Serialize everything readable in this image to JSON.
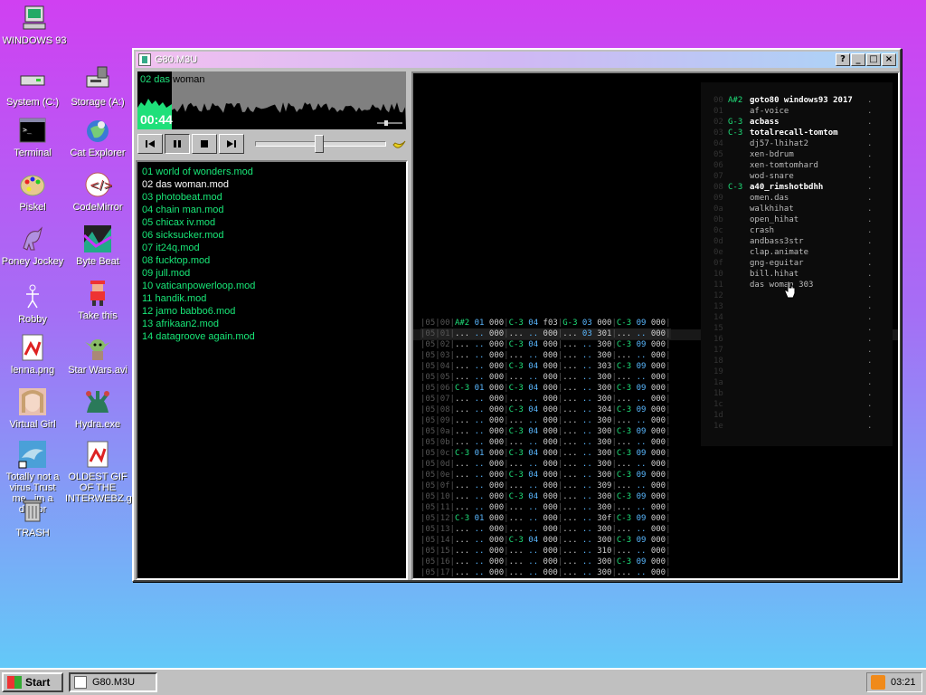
{
  "desktop": {
    "icons": [
      {
        "label": "WINDOWS 93"
      },
      {
        "label": "System (C:)"
      },
      {
        "label": "Storage (A:)"
      },
      {
        "label": "Terminal"
      },
      {
        "label": "Cat Explorer"
      },
      {
        "label": "Piskel"
      },
      {
        "label": "CodeMirror"
      },
      {
        "label": "Poney Jockey"
      },
      {
        "label": "Byte Beat"
      },
      {
        "label": "Robby"
      },
      {
        "label": "Take this"
      },
      {
        "label": "lenna.png"
      },
      {
        "label": "Star Wars.avi"
      },
      {
        "label": "Virtual Girl"
      },
      {
        "label": "Hydra.exe"
      },
      {
        "label": "Totally not a virus.Trust me...im a doctor"
      },
      {
        "label": "OLDEST GIF OF THE INTERWEBZ.gif"
      },
      {
        "label": "TRASH"
      }
    ]
  },
  "window": {
    "title": "G80.M3U",
    "buttons": {
      "help": "?",
      "minimize": "_",
      "maximize": "□",
      "close": "×"
    }
  },
  "player": {
    "now_playing_prefix": "02 das",
    "now_playing_rest": " woman",
    "time": "00:44",
    "seek_progress": 0.48
  },
  "playlist": {
    "current_index": 1,
    "items": [
      "01 world of wonders.mod",
      "02 das woman.mod",
      "03 photobeat.mod",
      "04 chain man.mod",
      "05 chicax iv.mod",
      "06 sicksucker.mod",
      "07 it24q.mod",
      "08 fucktop.mod",
      "09 jull.mod",
      "10 vaticanpowerloop.mod",
      "11 handik.mod",
      "12 jamo babbo6.mod",
      "13 afrikaan2.mod",
      "14 datagroove again.mod"
    ]
  },
  "samples": [
    {
      "n": "00",
      "k": "A#2",
      "name": "goto80 windows93 2017",
      "bold": true
    },
    {
      "n": "01",
      "k": "",
      "name": "af-voice",
      "bold": false
    },
    {
      "n": "02",
      "k": "G-3",
      "name": "acbass",
      "bold": true
    },
    {
      "n": "03",
      "k": "C-3",
      "name": "totalrecall-tomtom",
      "bold": true
    },
    {
      "n": "04",
      "k": "",
      "name": "dj57-lhihat2",
      "bold": false
    },
    {
      "n": "05",
      "k": "",
      "name": "xen-bdrum",
      "bold": false
    },
    {
      "n": "06",
      "k": "",
      "name": "xen-tomtomhard",
      "bold": false
    },
    {
      "n": "07",
      "k": "",
      "name": "wod-snare",
      "bold": false
    },
    {
      "n": "08",
      "k": "C-3",
      "name": "a40_rimshotbdhh",
      "bold": true
    },
    {
      "n": "09",
      "k": "",
      "name": "omen.das",
      "bold": false
    },
    {
      "n": "0a",
      "k": "",
      "name": "walkhihat",
      "bold": false
    },
    {
      "n": "0b",
      "k": "",
      "name": "open_hihat",
      "bold": false
    },
    {
      "n": "0c",
      "k": "",
      "name": "crash",
      "bold": false
    },
    {
      "n": "0d",
      "k": "",
      "name": "andbass3str",
      "bold": false
    },
    {
      "n": "0e",
      "k": "",
      "name": "clap.animate",
      "bold": false
    },
    {
      "n": "0f",
      "k": "",
      "name": "gng-eguitar",
      "bold": false
    },
    {
      "n": "10",
      "k": "",
      "name": "bill.hihat",
      "bold": false
    },
    {
      "n": "11",
      "k": "",
      "name": "das woman 303",
      "bold": false
    },
    {
      "n": "12",
      "k": "",
      "name": "",
      "bold": false
    },
    {
      "n": "13",
      "k": "",
      "name": "",
      "bold": false
    },
    {
      "n": "14",
      "k": "",
      "name": "",
      "bold": false
    },
    {
      "n": "15",
      "k": "",
      "name": "",
      "bold": false
    },
    {
      "n": "16",
      "k": "",
      "name": "",
      "bold": false
    },
    {
      "n": "17",
      "k": "",
      "name": "",
      "bold": false
    },
    {
      "n": "18",
      "k": "",
      "name": "",
      "bold": false
    },
    {
      "n": "19",
      "k": "",
      "name": "",
      "bold": false
    },
    {
      "n": "1a",
      "k": "",
      "name": "",
      "bold": false
    },
    {
      "n": "1b",
      "k": "",
      "name": "",
      "bold": false
    },
    {
      "n": "1c",
      "k": "",
      "name": "",
      "bold": false
    },
    {
      "n": "1d",
      "k": "",
      "name": "",
      "bold": false
    },
    {
      "n": "1e",
      "k": "",
      "name": "",
      "bold": false
    }
  ],
  "pattern": {
    "highlight_row": 1,
    "rows": [
      [
        "05",
        "00",
        "A#2 01 000",
        "C-3 04 f03",
        "G-3 03 000",
        "C-3 09 000"
      ],
      [
        "05",
        "01",
        "... .. 000",
        "... .. 000",
        "... 03 301",
        "... .. 000"
      ],
      [
        "05",
        "02",
        "... .. 000",
        "C-3 04 000",
        "... .. 300",
        "C-3 09 000"
      ],
      [
        "05",
        "03",
        "... .. 000",
        "... .. 000",
        "... .. 300",
        "... .. 000"
      ],
      [
        "05",
        "04",
        "... .. 000",
        "C-3 04 000",
        "... .. 303",
        "C-3 09 000"
      ],
      [
        "05",
        "05",
        "... .. 000",
        "... .. 000",
        "... .. 300",
        "... .. 000"
      ],
      [
        "05",
        "06",
        "C-3 01 000",
        "C-3 04 000",
        "... .. 300",
        "C-3 09 000"
      ],
      [
        "05",
        "07",
        "... .. 000",
        "... .. 000",
        "... .. 300",
        "... .. 000"
      ],
      [
        "05",
        "08",
        "... .. 000",
        "C-3 04 000",
        "... .. 304",
        "C-3 09 000"
      ],
      [
        "05",
        "09",
        "... .. 000",
        "... .. 000",
        "... .. 300",
        "... .. 000"
      ],
      [
        "05",
        "0a",
        "... .. 000",
        "C-3 04 000",
        "... .. 300",
        "C-3 09 000"
      ],
      [
        "05",
        "0b",
        "... .. 000",
        "... .. 000",
        "... .. 300",
        "... .. 000"
      ],
      [
        "05",
        "0c",
        "C-3 01 000",
        "C-3 04 000",
        "... .. 300",
        "C-3 09 000"
      ],
      [
        "05",
        "0d",
        "... .. 000",
        "... .. 000",
        "... .. 300",
        "... .. 000"
      ],
      [
        "05",
        "0e",
        "... .. 000",
        "C-3 04 000",
        "... .. 300",
        "C-3 09 000"
      ],
      [
        "05",
        "0f",
        "... .. 000",
        "... .. 000",
        "... .. 309",
        "... .. 000"
      ],
      [
        "05",
        "10",
        "... .. 000",
        "C-3 04 000",
        "... .. 300",
        "C-3 09 000"
      ],
      [
        "05",
        "11",
        "... .. 000",
        "... .. 000",
        "... .. 300",
        "... .. 000"
      ],
      [
        "05",
        "12",
        "C-3 01 000",
        "... .. 000",
        "... .. 30f",
        "C-3 09 000"
      ],
      [
        "05",
        "13",
        "... .. 000",
        "... .. 000",
        "... .. 300",
        "... .. 000"
      ],
      [
        "05",
        "14",
        "... .. 000",
        "C-3 04 000",
        "... .. 300",
        "C-3 09 000"
      ],
      [
        "05",
        "15",
        "... .. 000",
        "... .. 000",
        "... .. 310",
        "... .. 000"
      ],
      [
        "05",
        "16",
        "... .. 000",
        "... .. 000",
        "... .. 300",
        "C-3 09 000"
      ],
      [
        "05",
        "17",
        "... .. 000",
        "... .. 000",
        "... .. 300",
        "... .. 000"
      ]
    ]
  },
  "taskbar": {
    "start_label": "Start",
    "task_label": "G80.M3U",
    "clock": "03:21"
  },
  "colors": {
    "accent": "#1fe07a",
    "instrument": "#5ab8ff"
  }
}
